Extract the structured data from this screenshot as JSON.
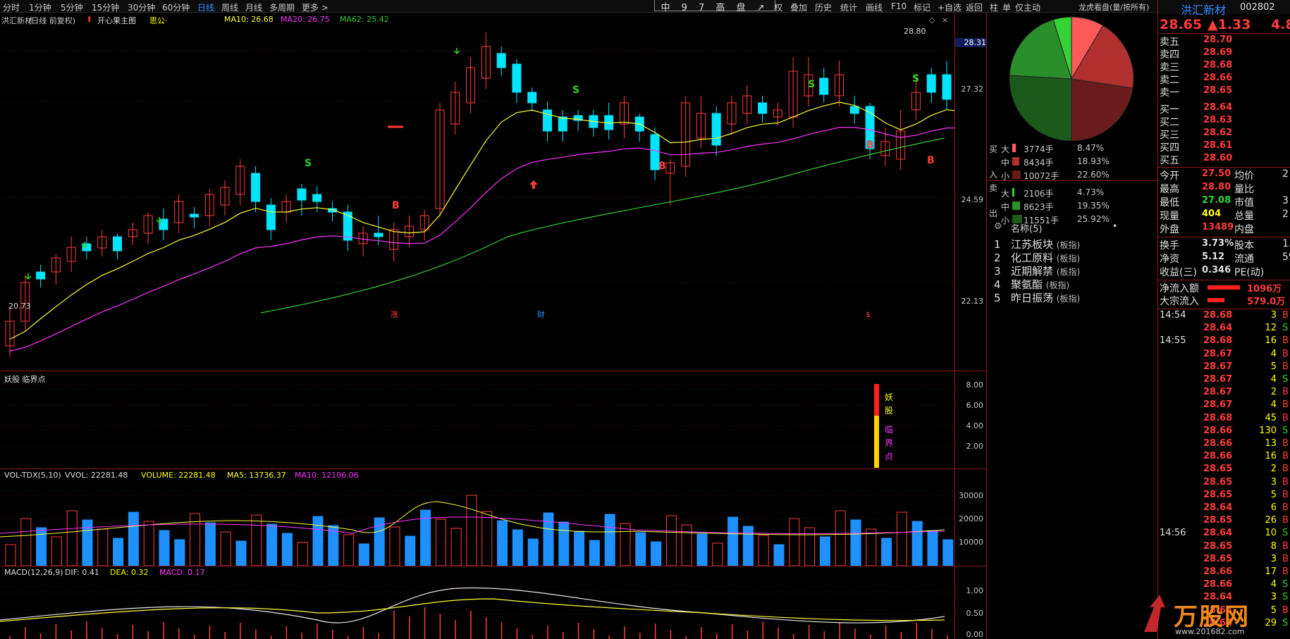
{
  "toolbar": {
    "periods": [
      "分时",
      "1分钟",
      "5分钟",
      "15分钟",
      "30分钟",
      "60分钟",
      "日线",
      "周线",
      "月线",
      "多周期",
      "更多 >"
    ],
    "active_period": "日线",
    "right_tools": [
      "权",
      "叠加",
      "历史",
      "统计",
      "画线",
      "F10",
      "标记",
      "+自选",
      "返回"
    ],
    "floating_title": "中 9 7 高 盘 ↗",
    "right_tabs": [
      "柱",
      "单",
      "仅主动"
    ],
    "dragon_tiger": "龙虎看盘(量/按所有)"
  },
  "chart_header": {
    "stock": "洪汇新材",
    "adj": "(日线 前复权)",
    "indicator": "开心果主图",
    "extra": "思公·",
    "ma10": "MA10: 26.68",
    "ma20": "MA20: 26.75",
    "ma62": "MA62: 25.42"
  },
  "price_axis": [
    "28.31",
    "27.32",
    "24.59",
    "22.13"
  ],
  "price_max_label": "28.80",
  "price_min_label": "20.73",
  "event_marks": [
    "涨",
    "财",
    "$"
  ],
  "candle_signals": [
    "S",
    "S",
    "S",
    "S",
    "B",
    "B",
    "B",
    "B"
  ],
  "panel2": {
    "title": "妖股 临界点",
    "axis": [
      "8.00",
      "6.00",
      "4.00",
      "2.00"
    ],
    "bar_labels": [
      "妖",
      "股",
      "临",
      "界",
      "点"
    ]
  },
  "volume_panel": {
    "title": "VOL-TDX(5,10)",
    "vvol": "VVOL: 22281.48",
    "volume": "VOLUME: 22281.48",
    "ma5": "MA5: 13736.37",
    "ma10": "MA10: 12106.06",
    "axis": [
      "30000",
      "20000",
      "10000"
    ]
  },
  "macd_panel": {
    "title": "MACD(12,26,9)",
    "dif": "DIF: 0.41",
    "dea": "DEA: 0.32",
    "macd": "MACD: 0.17",
    "axis": [
      "1.00",
      "0.50",
      "0.00"
    ]
  },
  "flow": {
    "buy_label": [
      "买",
      "入"
    ],
    "sell_label": [
      "卖",
      "出"
    ],
    "rows": [
      {
        "size": "大",
        "hands": "3774手",
        "pct": "8.47%",
        "color": "#ff5a5a",
        "frac": 0.33
      },
      {
        "size": "中",
        "hands": "8434手",
        "pct": "18.93%",
        "color": "#b03030",
        "frac": 0.73
      },
      {
        "size": "小",
        "hands": "10072手",
        "pct": "22.60%",
        "color": "#6a1c1c",
        "frac": 0.87
      },
      {
        "size": "大",
        "hands": "2106手",
        "pct": "4.73%",
        "color": "#36d336",
        "frac": 0.18
      },
      {
        "size": "中",
        "hands": "8623手",
        "pct": "19.35%",
        "color": "#2a8f2a",
        "frac": 0.75
      },
      {
        "size": "小",
        "hands": "11551手",
        "pct": "25.92%",
        "color": "#1c5a1c",
        "frac": 1.0
      }
    ]
  },
  "blocks": {
    "header": "名称(5)",
    "items": [
      {
        "n": "1",
        "name": "江苏板块",
        "tag": "(板指)"
      },
      {
        "n": "2",
        "name": "化工原料",
        "tag": "(板指)"
      },
      {
        "n": "3",
        "name": "近期解禁",
        "tag": "(板指)"
      },
      {
        "n": "4",
        "name": "聚氨酯",
        "tag": "(板指)"
      },
      {
        "n": "5",
        "name": "昨日振荡",
        "tag": "(板指)"
      }
    ]
  },
  "quote": {
    "name": "洪汇新材",
    "code": "002802",
    "price": "28.65",
    "change": "▲1.33",
    "pct": "4.8",
    "asks": [
      [
        "卖五",
        "28.70"
      ],
      [
        "卖四",
        "28.69"
      ],
      [
        "卖三",
        "28.68"
      ],
      [
        "卖二",
        "28.66"
      ],
      [
        "卖一",
        "28.65"
      ]
    ],
    "bids": [
      [
        "买一",
        "28.64"
      ],
      [
        "买二",
        "28.63"
      ],
      [
        "买三",
        "28.62"
      ],
      [
        "买四",
        "28.61"
      ],
      [
        "买五",
        "28.60"
      ]
    ],
    "stats": [
      [
        "今开",
        "27.50",
        "均价",
        "2"
      ],
      [
        "最高",
        "28.80",
        "量比",
        ""
      ],
      [
        "最低",
        "27.08",
        "市值",
        "3"
      ],
      [
        "现量",
        "404",
        "总量",
        "2"
      ],
      [
        "外盘",
        "13489",
        "内盘",
        ""
      ]
    ],
    "stats2": [
      [
        "换手",
        "3.73%",
        "股本",
        "1."
      ],
      [
        "净资",
        "5.12",
        "流通",
        "59"
      ],
      [
        "收益(三)",
        "0.346",
        "PE(动)",
        ""
      ]
    ],
    "flow_in": [
      [
        "净流入额",
        "1096万"
      ],
      [
        "大宗流入",
        "579.0万"
      ]
    ],
    "ticks": [
      {
        "t": "14:54",
        "p": "28.68",
        "v": "3",
        "s": "B"
      },
      {
        "t": "",
        "p": "28.64",
        "v": "12",
        "s": "S"
      },
      {
        "t": "14:55",
        "p": "28.68",
        "v": "16",
        "s": "B"
      },
      {
        "t": "",
        "p": "28.67",
        "v": "4",
        "s": "B"
      },
      {
        "t": "",
        "p": "28.67",
        "v": "5",
        "s": "B"
      },
      {
        "t": "",
        "p": "28.67",
        "v": "4",
        "s": "S"
      },
      {
        "t": "",
        "p": "28.67",
        "v": "2",
        "s": "B"
      },
      {
        "t": "",
        "p": "28.67",
        "v": "4",
        "s": "B"
      },
      {
        "t": "",
        "p": "28.68",
        "v": "45",
        "s": "B"
      },
      {
        "t": "",
        "p": "28.66",
        "v": "130",
        "s": "S"
      },
      {
        "t": "",
        "p": "28.66",
        "v": "13",
        "s": "B"
      },
      {
        "t": "",
        "p": "28.66",
        "v": "16",
        "s": "B"
      },
      {
        "t": "",
        "p": "28.65",
        "v": "2",
        "s": "B"
      },
      {
        "t": "",
        "p": "28.65",
        "v": "3",
        "s": "B"
      },
      {
        "t": "",
        "p": "28.65",
        "v": "5",
        "s": "B"
      },
      {
        "t": "",
        "p": "28.64",
        "v": "6",
        "s": "B"
      },
      {
        "t": "",
        "p": "28.65",
        "v": "26",
        "s": "B"
      },
      {
        "t": "14:56",
        "p": "28.64",
        "v": "10",
        "s": "S"
      },
      {
        "t": "",
        "p": "28.65",
        "v": "8",
        "s": "B"
      },
      {
        "t": "",
        "p": "28.65",
        "v": "3",
        "s": "B"
      },
      {
        "t": "",
        "p": "28.66",
        "v": "17",
        "s": "B"
      },
      {
        "t": "",
        "p": "28.66",
        "v": "4",
        "s": "S"
      },
      {
        "t": "",
        "p": "28.64",
        "v": "3",
        "s": "S"
      },
      {
        "t": "",
        "p": "28.64",
        "v": "5",
        "s": "B"
      },
      {
        "t": "",
        "p": "28.64",
        "v": "29",
        "s": "S"
      }
    ]
  },
  "watermark": "万股网",
  "watermark_url": "www.201682.com",
  "colors": {
    "up": "#ff3b3b",
    "down": "#00e5ff",
    "ma10": "#ffff33",
    "ma20": "#ff33ff",
    "ma62": "#33cc33",
    "border": "#8a1c1c"
  }
}
